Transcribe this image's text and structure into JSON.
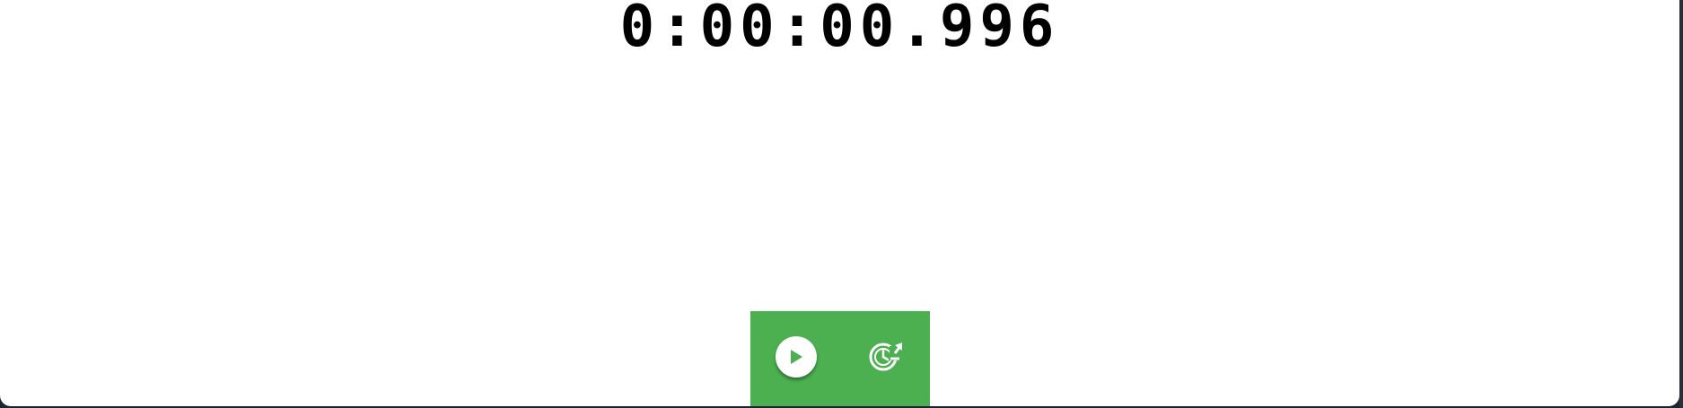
{
  "stopwatch": {
    "display": "0:00:00.996"
  },
  "controls": {
    "background_color": "#4caf50",
    "play_icon": "play-icon",
    "reset_icon": "reset-timer-icon"
  }
}
